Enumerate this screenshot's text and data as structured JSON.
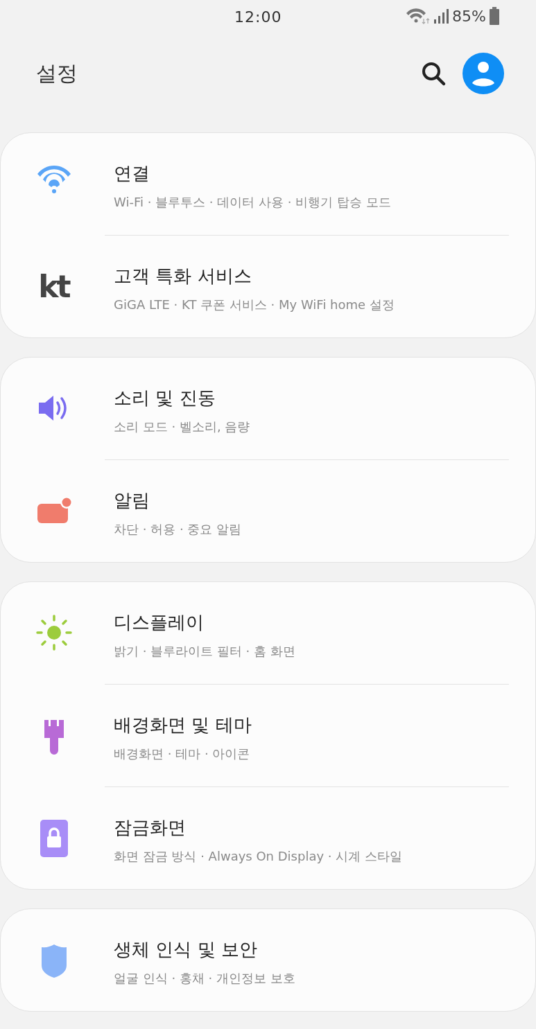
{
  "status_bar": {
    "time": "12:00",
    "battery": "85%"
  },
  "header": {
    "title": "설정"
  },
  "groups": [
    {
      "items": [
        {
          "title": "연결",
          "subtitle": "Wi-Fi · 블루투스 · 데이터 사용 · 비행기 탑승 모드"
        },
        {
          "logo_text": "kt",
          "title": "고객 특화 서비스",
          "subtitle": "GiGA LTE · KT 쿠폰 서비스 · My WiFi home 설정"
        }
      ]
    },
    {
      "items": [
        {
          "title": "소리 및 진동",
          "subtitle": "소리 모드 · 벨소리, 음량"
        },
        {
          "title": "알림",
          "subtitle": "차단 · 허용 · 중요 알림"
        }
      ]
    },
    {
      "items": [
        {
          "title": "디스플레이",
          "subtitle": "밝기 · 블루라이트 필터 · 홈 화면"
        },
        {
          "title": "배경화면 및 테마",
          "subtitle": "배경화면 · 테마 · 아이콘"
        },
        {
          "title": "잠금화면",
          "subtitle": "화면 잠금 방식 · Always On Display · 시계 스타일"
        }
      ]
    },
    {
      "items": [
        {
          "title": "생체 인식 및 보안",
          "subtitle": "얼굴 인식 · 홍채 · 개인정보 보호"
        }
      ]
    }
  ]
}
